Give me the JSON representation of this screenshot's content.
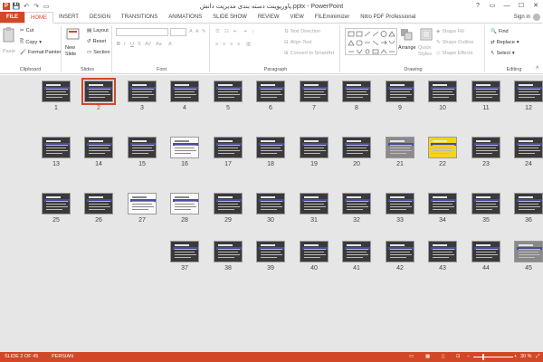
{
  "window": {
    "title": "پاورپوینت دسته بندی مدیریت دانش.pptx - PowerPoint",
    "controls": [
      "?",
      "▭",
      "—",
      "☐",
      "✕"
    ]
  },
  "tabs": [
    "FILE",
    "HOME",
    "INSERT",
    "DESIGN",
    "TRANSITIONS",
    "ANIMATIONS",
    "SLIDE SHOW",
    "REVIEW",
    "VIEW",
    "FILEminimizer",
    "Nitro PDF Professional"
  ],
  "active_tab": "HOME",
  "signin": "Sign in",
  "ribbon": {
    "clipboard": {
      "label": "Clipboard",
      "paste": "Paste",
      "cut": "Cut",
      "copy": "Copy",
      "format_painter": "Format Painter"
    },
    "slides": {
      "label": "Slides",
      "new_slide": "New Slide",
      "layout": "Layout",
      "reset": "Reset",
      "section": "Section"
    },
    "font": {
      "label": "Font"
    },
    "paragraph": {
      "label": "Paragraph",
      "text_direction": "Text Direction",
      "align_text": "Align Text",
      "convert_smartart": "Convert to SmartArt"
    },
    "drawing": {
      "label": "Drawing",
      "arrange": "Arrange",
      "quick_styles": "Quick Styles",
      "shape_fill": "Shape Fill",
      "shape_outline": "Shape Outline",
      "shape_effects": "Shape Effects"
    },
    "editing": {
      "label": "Editing",
      "find": "Find",
      "replace": "Replace",
      "select": "Select"
    }
  },
  "slides": [
    {
      "n": "12",
      "style": "dark"
    },
    {
      "n": "11",
      "style": "dark"
    },
    {
      "n": "10",
      "style": "dark"
    },
    {
      "n": "9",
      "style": "dark"
    },
    {
      "n": "8",
      "style": "dark"
    },
    {
      "n": "7",
      "style": "dark"
    },
    {
      "n": "6",
      "style": "dark"
    },
    {
      "n": "5",
      "style": "dark"
    },
    {
      "n": "4",
      "style": "dark"
    },
    {
      "n": "3",
      "style": "dark"
    },
    {
      "n": "2",
      "style": "dark",
      "selected": true
    },
    {
      "n": "1",
      "style": "dark"
    },
    {
      "n": "24",
      "style": "dark"
    },
    {
      "n": "23",
      "style": "dark"
    },
    {
      "n": "22",
      "style": "yellow"
    },
    {
      "n": "21",
      "style": "photo"
    },
    {
      "n": "20",
      "style": "dark"
    },
    {
      "n": "19",
      "style": "dark"
    },
    {
      "n": "18",
      "style": "dark"
    },
    {
      "n": "17",
      "style": "dark"
    },
    {
      "n": "16",
      "style": "white"
    },
    {
      "n": "15",
      "style": "dark"
    },
    {
      "n": "14",
      "style": "dark"
    },
    {
      "n": "13",
      "style": "dark"
    },
    {
      "n": "36",
      "style": "dark"
    },
    {
      "n": "35",
      "style": "dark"
    },
    {
      "n": "34",
      "style": "dark"
    },
    {
      "n": "33",
      "style": "dark"
    },
    {
      "n": "32",
      "style": "dark"
    },
    {
      "n": "31",
      "style": "dark"
    },
    {
      "n": "30",
      "style": "dark"
    },
    {
      "n": "29",
      "style": "dark"
    },
    {
      "n": "28",
      "style": "white"
    },
    {
      "n": "27",
      "style": "white"
    },
    {
      "n": "26",
      "style": "dark"
    },
    {
      "n": "25",
      "style": "dark"
    },
    {
      "n": "45",
      "style": "photo"
    },
    {
      "n": "44",
      "style": "dark"
    },
    {
      "n": "43",
      "style": "dark"
    },
    {
      "n": "42",
      "style": "dark"
    },
    {
      "n": "41",
      "style": "dark"
    },
    {
      "n": "40",
      "style": "dark"
    },
    {
      "n": "39",
      "style": "dark"
    },
    {
      "n": "38",
      "style": "dark"
    },
    {
      "n": "37",
      "style": "dark"
    }
  ],
  "status": {
    "slide_info": "SLIDE 2 OF 45",
    "language": "PERSIAN",
    "zoom": "30 %"
  },
  "colors": {
    "accent": "#d24726"
  }
}
